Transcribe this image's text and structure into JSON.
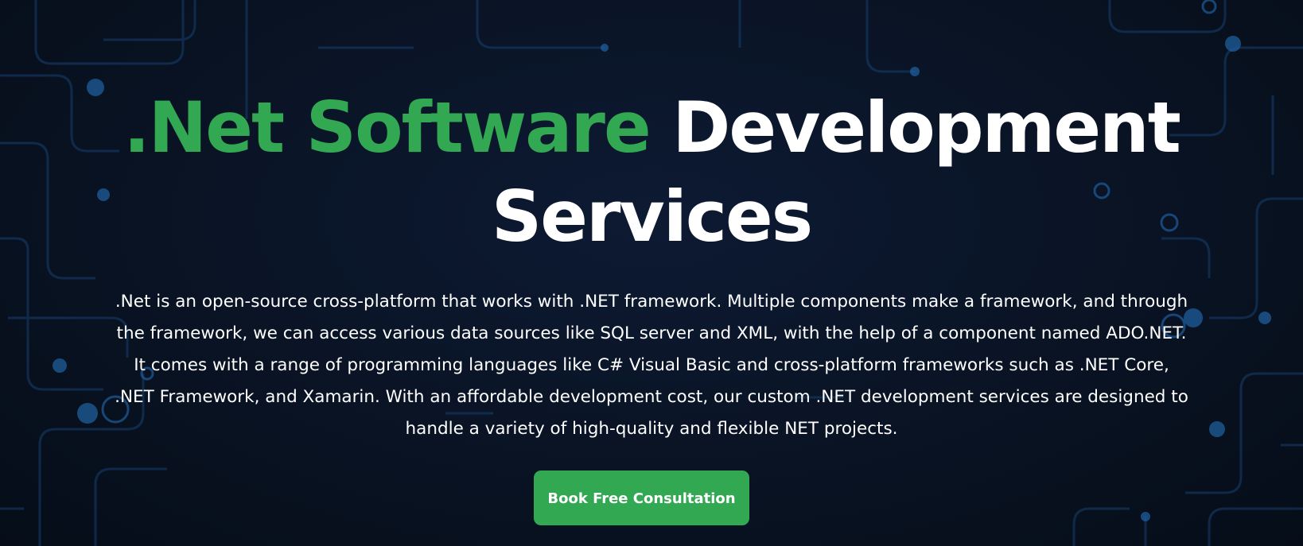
{
  "hero": {
    "title_accent": ".Net Software",
    "title_rest": " Development Services",
    "description": ".Net is an open-source cross-platform that works with .NET framework. Multiple components make a framework, and through the framework, we can access various data sources like SQL server and XML, with the help of a component named ADO.NET. It comes with a range of programming languages like C# Visual Basic and cross-platform frameworks such as .NET Core, .NET Framework, and Xamarin. With an affordable development cost, our custom .NET development services are designed to handle a variety of high-quality and flexible NET projects.",
    "cta_label": "Book Free Consultation"
  },
  "colors": {
    "accent": "#33a852",
    "background": "#0a1326",
    "text": "#ffffff",
    "circuit": "#1c4f86"
  }
}
